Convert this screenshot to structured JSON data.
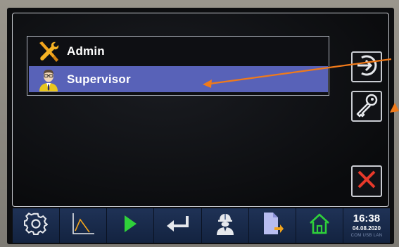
{
  "users": [
    {
      "label": "Admin",
      "icon": "wrench-screwdriver-icon",
      "selected": false
    },
    {
      "label": "Supervisor",
      "icon": "supervisor-avatar-icon",
      "selected": true
    }
  ],
  "side_buttons": {
    "logout": "logout-arrow-icon",
    "key": "key-icon",
    "close": "close-x-icon"
  },
  "toolbar": [
    {
      "name": "settings",
      "icon": "gear-icon"
    },
    {
      "name": "trend",
      "icon": "chart-icon"
    },
    {
      "name": "start",
      "icon": "play-icon"
    },
    {
      "name": "enter",
      "icon": "enter-return-icon"
    },
    {
      "name": "login",
      "icon": "worker-helmet-icon"
    },
    {
      "name": "export",
      "icon": "document-export-icon"
    },
    {
      "name": "home",
      "icon": "home-icon"
    }
  ],
  "clock": {
    "time": "16:38",
    "date": "04.08.2020",
    "status": "COM USB LAN"
  },
  "colors": {
    "selection": "#5862b8",
    "annotation_arrow": "#f07a1a",
    "close_red": "#e8392a",
    "play_green": "#2fd13a",
    "home_green": "#2fd13a"
  }
}
